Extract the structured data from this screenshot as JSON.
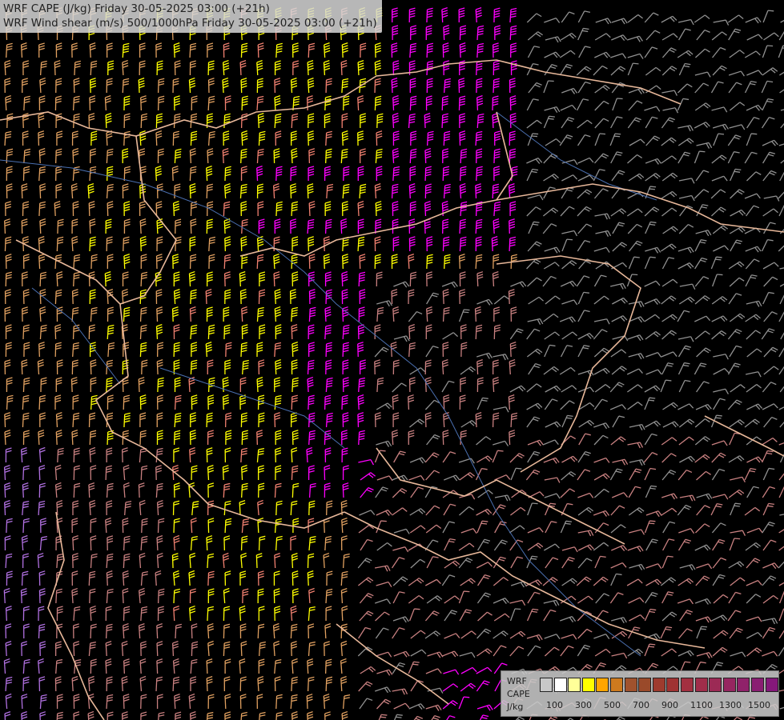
{
  "title": {
    "line1": "WRF CAPE (J/kg) Friday 30-05-2025 03:00 (+21h)",
    "line2": "WRF Wind shear (m/s) 500/1000hPa Friday 30-05-2025 03:00 (+21h)"
  },
  "legend": {
    "model": "WRF",
    "field": "CAPE",
    "unit": "J/kg",
    "colors": [
      "#c8c8c8",
      "#ffffff",
      "#ffff99",
      "#ffff00",
      "#ffa500",
      "#cd7a1e",
      "#a0522d",
      "#9a4a2a",
      "#9e3b2e",
      "#a03232",
      "#a33040",
      "#a02d4a",
      "#9c2a55",
      "#962660",
      "#90226a",
      "#8a1e72",
      "#85187a"
    ],
    "ticks": [
      "100",
      "300",
      "500",
      "700",
      "900",
      "1100",
      "1300",
      "1500"
    ]
  },
  "map_colors": {
    "background": "#000000",
    "borders": "#e8b89a",
    "rivers": "#4a6fb0",
    "magenta": "#ff00ff",
    "yellow": "#ffff00",
    "salmon": "#f08070",
    "orange": "#e0a060",
    "gray": "#909090",
    "rose": "#c88080",
    "violet": "#b070e0"
  }
}
